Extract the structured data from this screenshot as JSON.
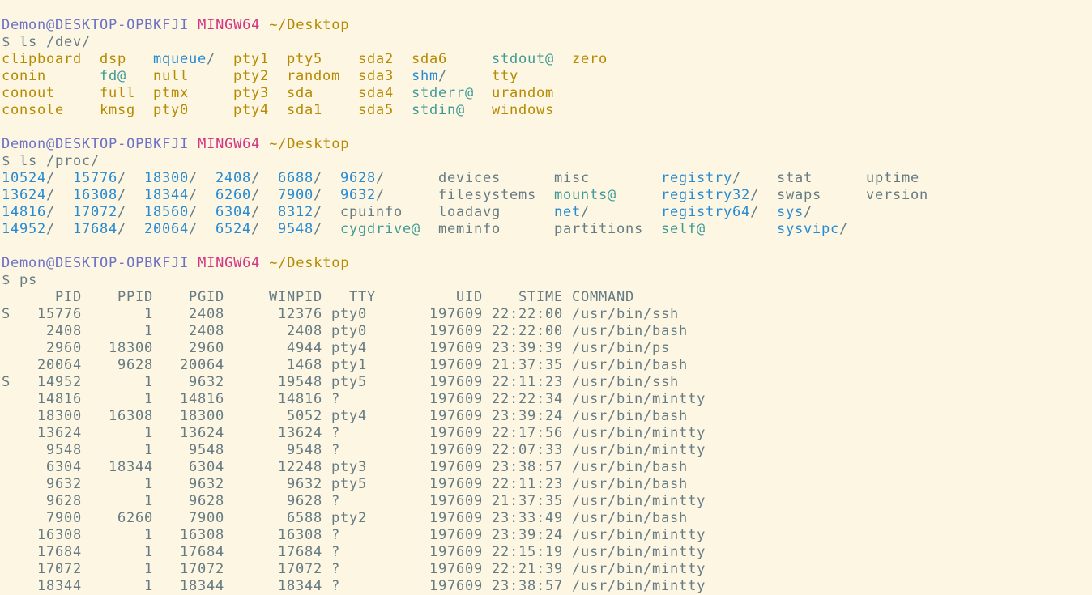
{
  "colors": {
    "background": "#fdf6e3",
    "text": "#657b83",
    "user_host": "#6c71c4",
    "system": "#d33682",
    "cwd": "#b58900",
    "device": "#b58900",
    "directory": "#268bd2",
    "symlink": "#3f9a96"
  },
  "prompt": {
    "user_host": "Demon@DESKTOP-OPBKFJI",
    "system": "MINGW64",
    "cwd": "~/Desktop"
  },
  "dev": {
    "command": "$ ls /dev/",
    "columns": [
      [
        {
          "name": "clipboard",
          "type": "device"
        },
        {
          "name": "conin",
          "type": "device"
        },
        {
          "name": "conout",
          "type": "device"
        },
        {
          "name": "console",
          "type": "device"
        }
      ],
      [
        {
          "name": "dsp",
          "type": "device"
        },
        {
          "name": "fd@",
          "type": "symlink"
        },
        {
          "name": "full",
          "type": "device"
        },
        {
          "name": "kmsg",
          "type": "device"
        }
      ],
      [
        {
          "name": "mqueue",
          "type": "directory"
        },
        {
          "name": "null",
          "type": "device"
        },
        {
          "name": "ptmx",
          "type": "device"
        },
        {
          "name": "pty0",
          "type": "device"
        }
      ],
      [
        {
          "name": "pty1",
          "type": "device"
        },
        {
          "name": "pty2",
          "type": "device"
        },
        {
          "name": "pty3",
          "type": "device"
        },
        {
          "name": "pty4",
          "type": "device"
        }
      ],
      [
        {
          "name": "pty5",
          "type": "device"
        },
        {
          "name": "random",
          "type": "device"
        },
        {
          "name": "sda",
          "type": "device"
        },
        {
          "name": "sda1",
          "type": "device"
        }
      ],
      [
        {
          "name": "sda2",
          "type": "device"
        },
        {
          "name": "sda3",
          "type": "device"
        },
        {
          "name": "sda4",
          "type": "device"
        },
        {
          "name": "sda5",
          "type": "device"
        }
      ],
      [
        {
          "name": "sda6",
          "type": "device"
        },
        {
          "name": "shm",
          "type": "directory"
        },
        {
          "name": "stderr@",
          "type": "symlink"
        },
        {
          "name": "stdin@",
          "type": "symlink"
        }
      ],
      [
        {
          "name": "stdout@",
          "type": "symlink"
        },
        {
          "name": "tty",
          "type": "device"
        },
        {
          "name": "urandom",
          "type": "device"
        },
        {
          "name": "windows",
          "type": "device"
        }
      ],
      [
        {
          "name": "zero",
          "type": "device"
        }
      ]
    ]
  },
  "proc": {
    "command": "$ ls /proc/",
    "columns": [
      [
        {
          "name": "10524",
          "type": "directory"
        },
        {
          "name": "13624",
          "type": "directory"
        },
        {
          "name": "14816",
          "type": "directory"
        },
        {
          "name": "14952",
          "type": "directory"
        }
      ],
      [
        {
          "name": "15776",
          "type": "directory"
        },
        {
          "name": "16308",
          "type": "directory"
        },
        {
          "name": "17072",
          "type": "directory"
        },
        {
          "name": "17684",
          "type": "directory"
        }
      ],
      [
        {
          "name": "18300",
          "type": "directory"
        },
        {
          "name": "18344",
          "type": "directory"
        },
        {
          "name": "18560",
          "type": "directory"
        },
        {
          "name": "20064",
          "type": "directory"
        }
      ],
      [
        {
          "name": "2408",
          "type": "directory"
        },
        {
          "name": "6260",
          "type": "directory"
        },
        {
          "name": "6304",
          "type": "directory"
        },
        {
          "name": "6524",
          "type": "directory"
        }
      ],
      [
        {
          "name": "6688",
          "type": "directory"
        },
        {
          "name": "7900",
          "type": "directory"
        },
        {
          "name": "8312",
          "type": "directory"
        },
        {
          "name": "9548",
          "type": "directory"
        }
      ],
      [
        {
          "name": "9628",
          "type": "directory"
        },
        {
          "name": "9632",
          "type": "directory"
        },
        {
          "name": "cpuinfo",
          "type": "file"
        },
        {
          "name": "cygdrive@",
          "type": "symlink"
        }
      ],
      [
        {
          "name": "devices",
          "type": "file"
        },
        {
          "name": "filesystems",
          "type": "file"
        },
        {
          "name": "loadavg",
          "type": "file"
        },
        {
          "name": "meminfo",
          "type": "file"
        }
      ],
      [
        {
          "name": "misc",
          "type": "file"
        },
        {
          "name": "mounts@",
          "type": "symlink"
        },
        {
          "name": "net",
          "type": "directory"
        },
        {
          "name": "partitions",
          "type": "file"
        }
      ],
      [
        {
          "name": "registry",
          "type": "directory"
        },
        {
          "name": "registry32",
          "type": "directory"
        },
        {
          "name": "registry64",
          "type": "directory"
        },
        {
          "name": "self@",
          "type": "symlink"
        }
      ],
      [
        {
          "name": "stat",
          "type": "file"
        },
        {
          "name": "swaps",
          "type": "file"
        },
        {
          "name": "sys",
          "type": "directory"
        },
        {
          "name": "sysvipc",
          "type": "directory"
        }
      ],
      [
        {
          "name": "uptime",
          "type": "file"
        },
        {
          "name": "version",
          "type": "file"
        }
      ]
    ]
  },
  "ps": {
    "command": "$ ps",
    "header": [
      "",
      "PID",
      "PPID",
      "PGID",
      "WINPID",
      "TTY",
      "UID",
      "STIME",
      "COMMAND"
    ],
    "rows": [
      [
        "S",
        "15776",
        "1",
        "2408",
        "12376",
        "pty0",
        "197609",
        "22:22:00",
        "/usr/bin/ssh"
      ],
      [
        "",
        "2408",
        "1",
        "2408",
        "2408",
        "pty0",
        "197609",
        "22:22:00",
        "/usr/bin/bash"
      ],
      [
        "",
        "2960",
        "18300",
        "2960",
        "4944",
        "pty4",
        "197609",
        "23:39:39",
        "/usr/bin/ps"
      ],
      [
        "",
        "20064",
        "9628",
        "20064",
        "1468",
        "pty1",
        "197609",
        "21:37:35",
        "/usr/bin/bash"
      ],
      [
        "S",
        "14952",
        "1",
        "9632",
        "19548",
        "pty5",
        "197609",
        "22:11:23",
        "/usr/bin/ssh"
      ],
      [
        "",
        "14816",
        "1",
        "14816",
        "14816",
        "?",
        "197609",
        "22:22:34",
        "/usr/bin/mintty"
      ],
      [
        "",
        "18300",
        "16308",
        "18300",
        "5052",
        "pty4",
        "197609",
        "23:39:24",
        "/usr/bin/bash"
      ],
      [
        "",
        "13624",
        "1",
        "13624",
        "13624",
        "?",
        "197609",
        "22:17:56",
        "/usr/bin/mintty"
      ],
      [
        "",
        "9548",
        "1",
        "9548",
        "9548",
        "?",
        "197609",
        "22:07:33",
        "/usr/bin/mintty"
      ],
      [
        "",
        "6304",
        "18344",
        "6304",
        "12248",
        "pty3",
        "197609",
        "23:38:57",
        "/usr/bin/bash"
      ],
      [
        "",
        "9632",
        "1",
        "9632",
        "9632",
        "pty5",
        "197609",
        "22:11:23",
        "/usr/bin/bash"
      ],
      [
        "",
        "9628",
        "1",
        "9628",
        "9628",
        "?",
        "197609",
        "21:37:35",
        "/usr/bin/mintty"
      ],
      [
        "",
        "7900",
        "6260",
        "7900",
        "6588",
        "pty2",
        "197609",
        "23:33:49",
        "/usr/bin/bash"
      ],
      [
        "",
        "16308",
        "1",
        "16308",
        "16308",
        "?",
        "197609",
        "23:39:24",
        "/usr/bin/mintty"
      ],
      [
        "",
        "17684",
        "1",
        "17684",
        "17684",
        "?",
        "197609",
        "22:15:19",
        "/usr/bin/mintty"
      ],
      [
        "",
        "17072",
        "1",
        "17072",
        "17072",
        "?",
        "197609",
        "22:21:39",
        "/usr/bin/mintty"
      ],
      [
        "",
        "18344",
        "1",
        "18344",
        "18344",
        "?",
        "197609",
        "23:38:57",
        "/usr/bin/mintty"
      ]
    ]
  }
}
